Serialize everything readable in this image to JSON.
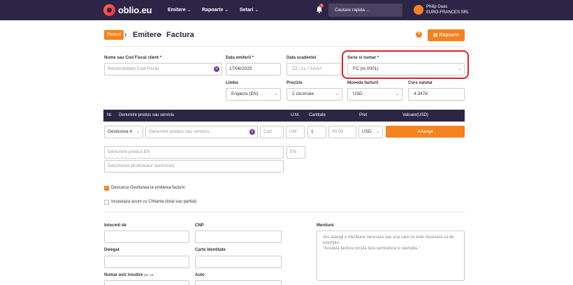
{
  "topbar": {
    "brand": "oblio.eu",
    "nav": [
      {
        "label": "Emitere"
      },
      {
        "label": "Rapoarte"
      },
      {
        "label": "Setari"
      }
    ],
    "notification_count": "1",
    "search_placeholder": "Cautare rapida ...",
    "user": {
      "name": "Philip Daas",
      "company": "EURO-FRANCES SRL"
    }
  },
  "breadcrumb": {
    "pill": "Stocuri",
    "items": [
      "Emitere",
      "Factura"
    ],
    "separator": "›"
  },
  "header": {
    "reports_button": "Rapoarte",
    "help": "?"
  },
  "form": {
    "client": {
      "label": "Nume sau Cod Fiscal client *",
      "placeholder": "Recomandam Cod Fiscal"
    },
    "issue_date": {
      "label": "Data emiterii *",
      "value": "17/06/2025"
    },
    "due_date": {
      "label": "Data scadentei",
      "placeholder": "ZZ / LL / AAAA"
    },
    "series": {
      "label": "Serie si numar *",
      "value": "FC (nr.0001)"
    },
    "language": {
      "label": "Limba",
      "value": "Engleza (EN)"
    },
    "precision": {
      "label": "Precizie",
      "value": "2 zecimale"
    },
    "currency": {
      "label": "Moneda facturii",
      "value": "USD"
    },
    "exchange_rate": {
      "label": "Curs valutar",
      "value": "4.3478"
    }
  },
  "products_table": {
    "headers": {
      "nr": "Nr.",
      "name": "Denumire produs sau serviciu",
      "um": "U.M.",
      "qty": "Cantitate",
      "price": "Pret",
      "value": "Valoare(USD)"
    },
    "row": {
      "warehouse": "Gestiunea 4",
      "name_placeholder": "Denumire produs sau serviciu...",
      "code_placeholder": "Cod",
      "um_placeholder": "UM",
      "qty": "1",
      "price_placeholder": "00.00",
      "currency": "USD",
      "add_button": "Adauga"
    },
    "name_en_placeholder": "Denumire produs EN",
    "en_label": "EN",
    "description_placeholder": "Descrierea produsului/ serviciului"
  },
  "options": [
    {
      "label": "Descarca Gestiunea la emiterea facturii",
      "checked": true
    },
    {
      "label": "Incaseaza acum cu Chitanta (total sau partial)",
      "checked": false
    }
  ],
  "footer_fields": {
    "prepared_by": "Intocmit de",
    "cnp": "CNP",
    "delegate": "Delegat",
    "id_card": "Carte Identitate",
    "delivery_note": "Numar aviz insotire",
    "delivery_note_hint": "(ex: ca",
    "auto": "Auto",
    "mentions": "Mentiuni",
    "mentions_placeholder": "Aici adaugi o mentiune necesara sau una care nu este necesara ca de exemplu:\n\"Aceasta factura circula fara semnatura si stampila.\""
  },
  "colors": {
    "brand_dark": "#2d2546",
    "accent": "#f4831f",
    "highlight": "#e0202a"
  }
}
